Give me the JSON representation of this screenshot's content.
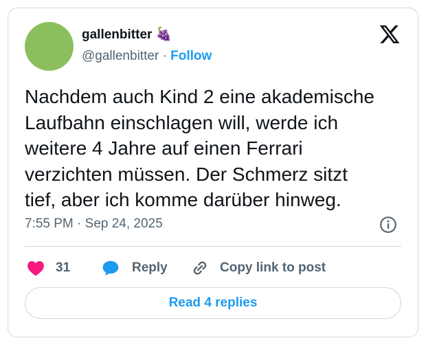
{
  "author": {
    "display_name": "gallenbitter 🍇",
    "handle": "@gallenbitter",
    "separator": "·",
    "follow_label": "Follow",
    "avatar_color": "#8bbf5e"
  },
  "tweet": {
    "lines": [
      "Nachdem auch Kind 2 eine akademische",
      "Laufbahn einschlagen will, werde ich",
      "weitere 4 Jahre auf einen Ferrari",
      "verzichten müssen. Der Schmerz sitzt",
      "tief, aber ich komme darüber hinweg."
    ],
    "timestamp": "7:55 PM · Sep 24, 2025"
  },
  "actions": {
    "like_count": "31",
    "reply_label": "Reply",
    "copy_label": "Copy link to post"
  },
  "read_replies_label": "Read 4 replies",
  "icons": {
    "platform_logo": "x-logo-icon",
    "info": "info-icon",
    "like": "heart-icon",
    "reply": "speech-bubble-icon",
    "copy": "link-icon"
  },
  "colors": {
    "accent": "#1d9bf0",
    "like": "#f91880",
    "text": "#0f1419",
    "muted": "#536471",
    "border": "#cfd9de"
  }
}
